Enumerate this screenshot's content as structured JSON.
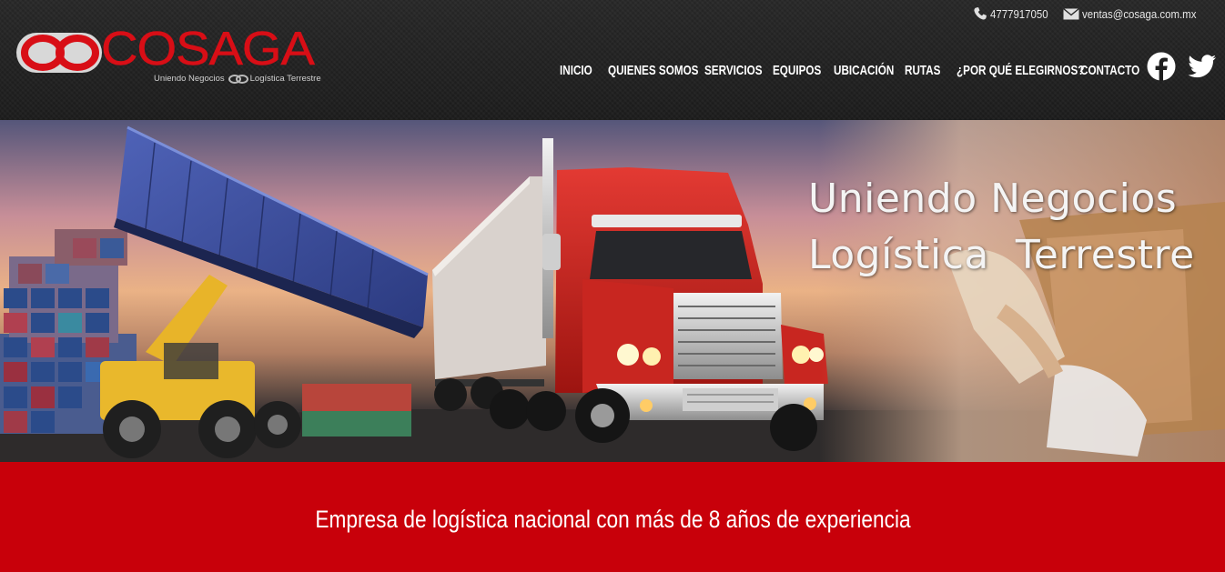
{
  "brand": {
    "name": "COSAGA",
    "tagline_left": "Uniendo Negocios",
    "tagline_right": "Logística Terrestre",
    "color": "#d80e16"
  },
  "contact": {
    "phone": "4777917050",
    "email": "ventas@cosaga.com.mx",
    "phone_icon": "phone-icon",
    "email_icon": "envelope-icon"
  },
  "nav": {
    "items": [
      {
        "label": "INICIO"
      },
      {
        "label": "QUIENES SOMOS"
      },
      {
        "label": "SERVICIOS"
      },
      {
        "label": "EQUIPOS"
      },
      {
        "label": "UBICACIÓN"
      },
      {
        "label": "RUTAS"
      },
      {
        "label": "¿POR QUÉ ELEGIRNOS?"
      },
      {
        "label": "CONTACTO"
      }
    ],
    "social": [
      "facebook-icon",
      "twitter-icon"
    ]
  },
  "hero": {
    "line1": "Uniendo Negocios",
    "line2": "Logística  Terrestre"
  },
  "banner": {
    "text": "Empresa de logística nacional con más de 8 años de experiencia",
    "color": "#c8000a"
  }
}
